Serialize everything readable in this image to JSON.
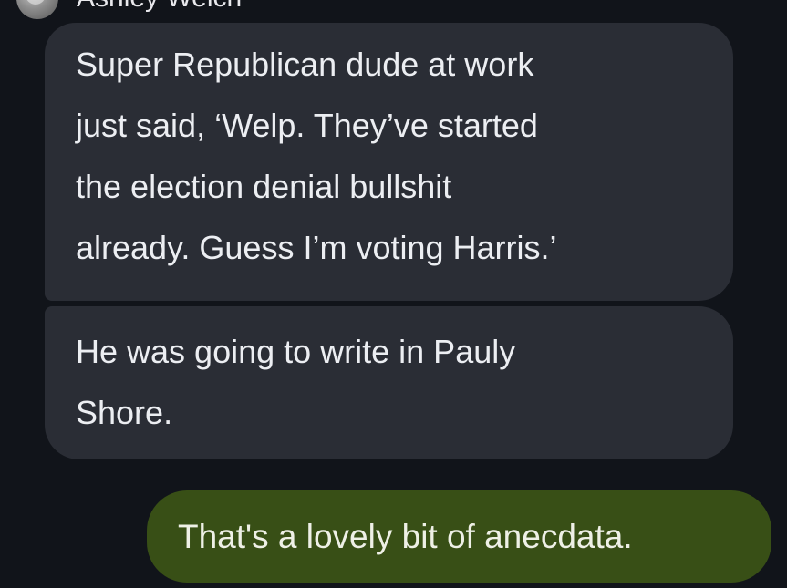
{
  "thread": {
    "sender_name": "Ashley Welch",
    "messages": [
      {
        "direction": "incoming",
        "lines": [
          "Super Republican dude at work",
          "just said, ‘Welp. They’ve started",
          "the election denial bullshit",
          "already. Guess I’m voting Harris.’"
        ]
      },
      {
        "direction": "incoming",
        "lines": [
          "He was going to write in Pauly",
          "Shore."
        ]
      },
      {
        "direction": "outgoing",
        "lines": [
          "That's a lovely bit of anecdata."
        ]
      }
    ]
  },
  "colors": {
    "background": "#11141a",
    "incoming_bubble": "#2a2d35",
    "outgoing_bubble": "#384f16",
    "text": "#eceef2"
  }
}
